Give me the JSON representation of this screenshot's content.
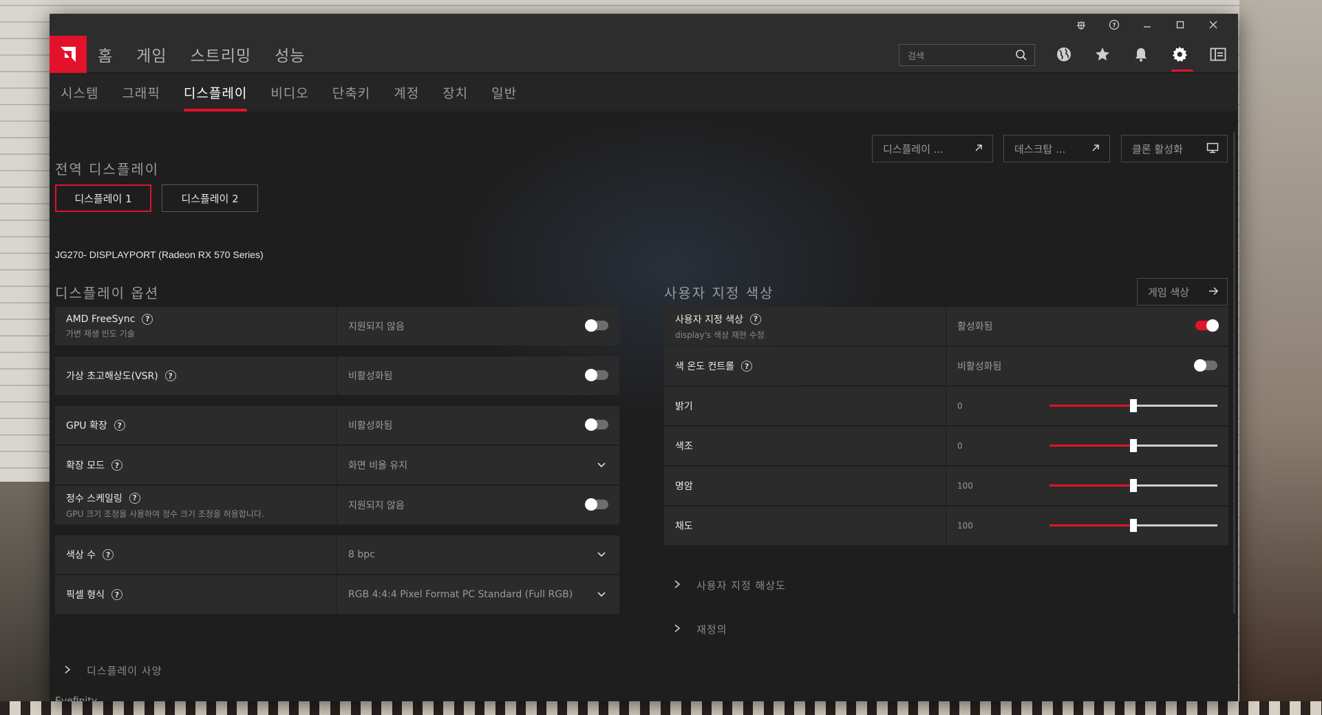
{
  "titlebar": {
    "icons": [
      "bug-icon",
      "help-icon",
      "minimize-icon",
      "maximize-icon",
      "close-icon"
    ]
  },
  "topnav": {
    "tabs": [
      {
        "label": "홈"
      },
      {
        "label": "게임"
      },
      {
        "label": "스트리밍"
      },
      {
        "label": "성능"
      }
    ],
    "search_placeholder": "검색",
    "icons": [
      "globe-icon",
      "star-icon",
      "bell-icon",
      "gear-icon",
      "sidebar-toggle-icon"
    ]
  },
  "subnav": {
    "tabs": [
      {
        "label": "시스템"
      },
      {
        "label": "그래픽"
      },
      {
        "label": "디스플레이"
      },
      {
        "label": "비디오"
      },
      {
        "label": "단축키"
      },
      {
        "label": "계정"
      },
      {
        "label": "장치"
      },
      {
        "label": "일반"
      }
    ],
    "active_index": 2
  },
  "global_display": {
    "title": "전역 디스플레이",
    "display1": "디스플레이 1",
    "display2": "디스플레이 2",
    "monitor": "JG270- DISPLAYPORT (Radeon RX 570 Series)"
  },
  "actions": {
    "display_link": "디스플레이 ...",
    "desktop_link": "데스크탑 ...",
    "clone": "클론 활성화",
    "game_color": "게임 색상"
  },
  "display_options": {
    "title": "디스플레이 옵션",
    "freesync_label": "AMD FreeSync",
    "freesync_sub": "가변 재생 빈도 기술",
    "freesync_value": "지원되지 않음",
    "vsr_label": "가상 초고해상도(VSR)",
    "vsr_value": "비활성화됨",
    "gpu_scaling_label": "GPU 확장",
    "gpu_scaling_value": "비활성화됨",
    "scaling_mode_label": "확장 모드",
    "scaling_mode_value": "화면 비율 유지",
    "integer_label": "정수 스케일링",
    "integer_sub": "GPU 크기 조정을 사용하여 정수 크기 조정을 허용합니다.",
    "integer_value": "지원되지 않음",
    "color_depth_label": "색상 수",
    "color_depth_value": "8 bpc",
    "pixel_format_label": "픽셀 형식",
    "pixel_format_value": "RGB 4:4:4 Pixel Format PC Standard (Full RGB)",
    "display_specs": "디스플레이 사양",
    "cutoff_text": "Eyefinity"
  },
  "custom_color": {
    "title": "사용자 지정 색상",
    "custom_label": "사용자 지정 색상",
    "custom_sub": "display's 색상 재현 수정",
    "custom_value": "활성화됨",
    "custom_on": true,
    "temp_label": "색 온도 컨트롤",
    "temp_value": "비활성화됨",
    "brightness_label": "밝기",
    "brightness_value": "0",
    "brightness_pct": 0.5,
    "hue_label": "색조",
    "hue_value": "0",
    "hue_pct": 0.5,
    "contrast_label": "명암",
    "contrast_value": "100",
    "contrast_pct": 0.5,
    "saturation_label": "채도",
    "saturation_value": "100",
    "saturation_pct": 0.5,
    "custom_resolution": "사용자 지정 해상도",
    "overrides": "재정의"
  },
  "colors": {
    "accent": "#e3122b",
    "panel": "#2b2b2b",
    "background": "#1e1e1e"
  }
}
